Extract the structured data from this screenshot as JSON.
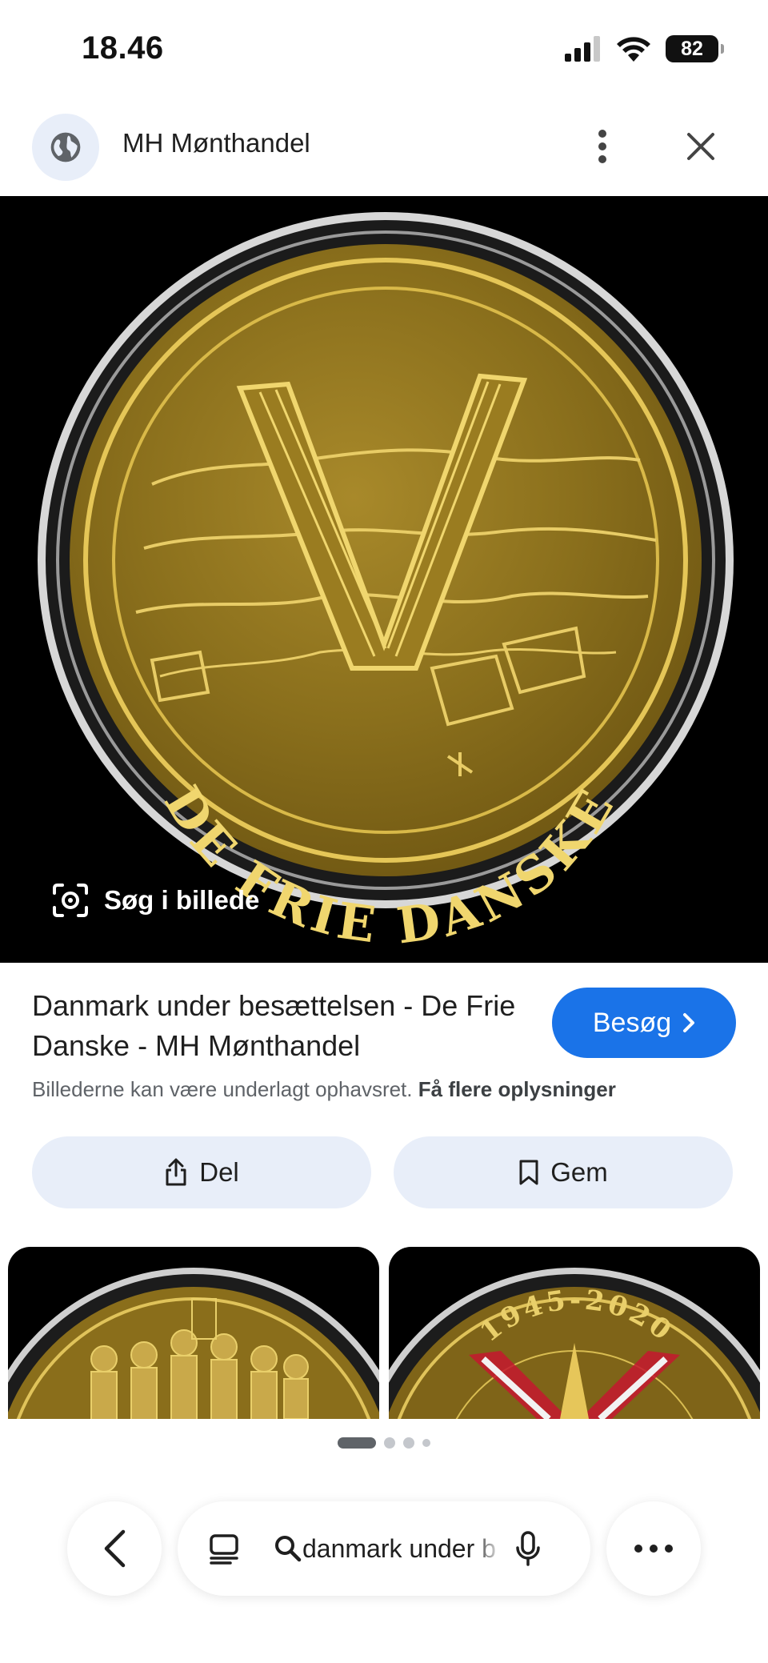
{
  "status_bar": {
    "time": "18.46",
    "battery": "82"
  },
  "header": {
    "site_name": "MH Mønthandel",
    "icons": {
      "site": "globe-icon",
      "more": "more-vertical-icon",
      "close": "close-icon"
    }
  },
  "main_image": {
    "coin_inscription": "DE FRIE DANSKE",
    "search_in_image_label": "Søg i billede"
  },
  "result": {
    "title": "Danmark under besættelsen - De Frie Danske - MH Mønthandel",
    "visit_label": "Besøg",
    "copyright_text": "Billederne kan være underlagt ophavsret.",
    "copyright_link": "Få flere oplysninger"
  },
  "actions": {
    "share_label": "Del",
    "save_label": "Gem"
  },
  "related": {
    "item2_inscription": "1945-2020"
  },
  "bottom_bar": {
    "search_query": "danmark under b",
    "icons": {
      "back": "chevron-left-icon",
      "tabs": "tabs-icon",
      "search": "search-icon",
      "mic": "mic-icon",
      "more": "more-horizontal-icon"
    }
  },
  "colors": {
    "accent": "#1a73e8",
    "chip_bg": "#e8eef9",
    "coin_gold": "#c9a227"
  }
}
